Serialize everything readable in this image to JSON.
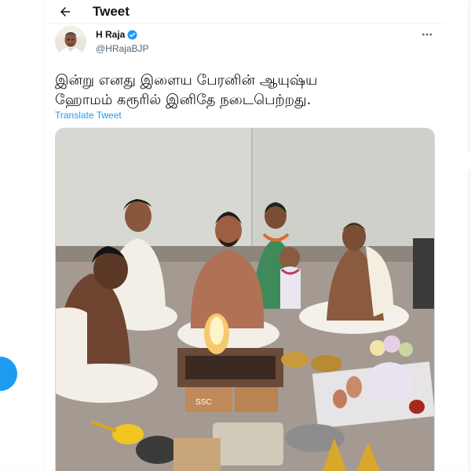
{
  "header": {
    "title": "Tweet",
    "back_icon": "arrow-left-icon"
  },
  "tweet": {
    "author": {
      "name": "H Raja",
      "handle": "@HRajaBJP",
      "verified": true,
      "avatar_icon": "avatar"
    },
    "more_icon": "more-horizontal-icon",
    "text": "இன்று எனது இளைய பேரனின் ஆயுஷ்ய\nஹோமம் கரூரில் இனிதே நடைபெற்றது.",
    "translate_label": "Translate Tweet",
    "media": {
      "alt_icon": "ritual-photo",
      "box_label": "SSC"
    }
  },
  "colors": {
    "accent": "#1d9bf0",
    "text": "#0f1419",
    "secondary": "#536471"
  }
}
